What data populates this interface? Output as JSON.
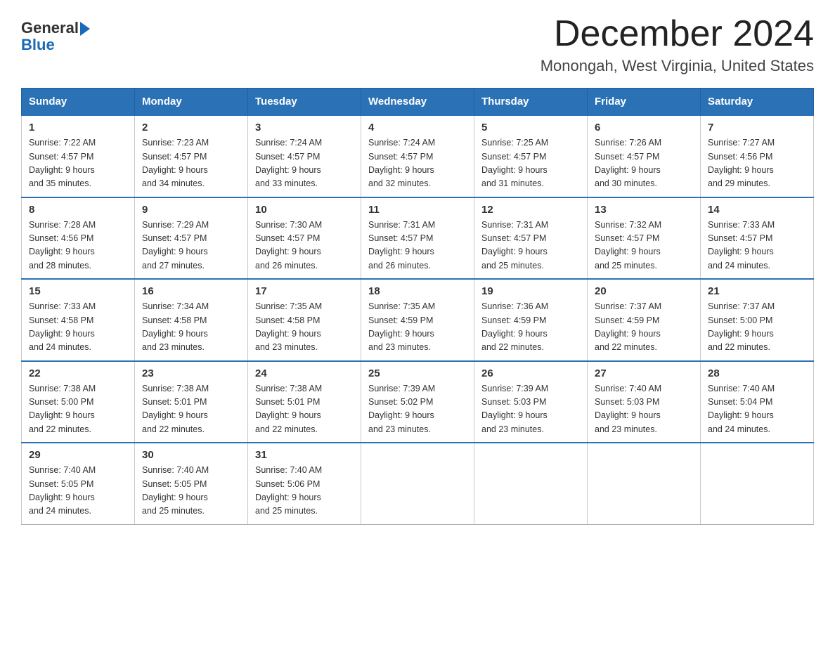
{
  "header": {
    "logo_text_general": "General",
    "logo_text_blue": "Blue",
    "month_title": "December 2024",
    "location": "Monongah, West Virginia, United States"
  },
  "days_of_week": [
    "Sunday",
    "Monday",
    "Tuesday",
    "Wednesday",
    "Thursday",
    "Friday",
    "Saturday"
  ],
  "weeks": [
    [
      {
        "day": "1",
        "sunrise": "7:22 AM",
        "sunset": "4:57 PM",
        "daylight": "9 hours and 35 minutes."
      },
      {
        "day": "2",
        "sunrise": "7:23 AM",
        "sunset": "4:57 PM",
        "daylight": "9 hours and 34 minutes."
      },
      {
        "day": "3",
        "sunrise": "7:24 AM",
        "sunset": "4:57 PM",
        "daylight": "9 hours and 33 minutes."
      },
      {
        "day": "4",
        "sunrise": "7:24 AM",
        "sunset": "4:57 PM",
        "daylight": "9 hours and 32 minutes."
      },
      {
        "day": "5",
        "sunrise": "7:25 AM",
        "sunset": "4:57 PM",
        "daylight": "9 hours and 31 minutes."
      },
      {
        "day": "6",
        "sunrise": "7:26 AM",
        "sunset": "4:57 PM",
        "daylight": "9 hours and 30 minutes."
      },
      {
        "day": "7",
        "sunrise": "7:27 AM",
        "sunset": "4:56 PM",
        "daylight": "9 hours and 29 minutes."
      }
    ],
    [
      {
        "day": "8",
        "sunrise": "7:28 AM",
        "sunset": "4:56 PM",
        "daylight": "9 hours and 28 minutes."
      },
      {
        "day": "9",
        "sunrise": "7:29 AM",
        "sunset": "4:57 PM",
        "daylight": "9 hours and 27 minutes."
      },
      {
        "day": "10",
        "sunrise": "7:30 AM",
        "sunset": "4:57 PM",
        "daylight": "9 hours and 26 minutes."
      },
      {
        "day": "11",
        "sunrise": "7:31 AM",
        "sunset": "4:57 PM",
        "daylight": "9 hours and 26 minutes."
      },
      {
        "day": "12",
        "sunrise": "7:31 AM",
        "sunset": "4:57 PM",
        "daylight": "9 hours and 25 minutes."
      },
      {
        "day": "13",
        "sunrise": "7:32 AM",
        "sunset": "4:57 PM",
        "daylight": "9 hours and 25 minutes."
      },
      {
        "day": "14",
        "sunrise": "7:33 AM",
        "sunset": "4:57 PM",
        "daylight": "9 hours and 24 minutes."
      }
    ],
    [
      {
        "day": "15",
        "sunrise": "7:33 AM",
        "sunset": "4:58 PM",
        "daylight": "9 hours and 24 minutes."
      },
      {
        "day": "16",
        "sunrise": "7:34 AM",
        "sunset": "4:58 PM",
        "daylight": "9 hours and 23 minutes."
      },
      {
        "day": "17",
        "sunrise": "7:35 AM",
        "sunset": "4:58 PM",
        "daylight": "9 hours and 23 minutes."
      },
      {
        "day": "18",
        "sunrise": "7:35 AM",
        "sunset": "4:59 PM",
        "daylight": "9 hours and 23 minutes."
      },
      {
        "day": "19",
        "sunrise": "7:36 AM",
        "sunset": "4:59 PM",
        "daylight": "9 hours and 22 minutes."
      },
      {
        "day": "20",
        "sunrise": "7:37 AM",
        "sunset": "4:59 PM",
        "daylight": "9 hours and 22 minutes."
      },
      {
        "day": "21",
        "sunrise": "7:37 AM",
        "sunset": "5:00 PM",
        "daylight": "9 hours and 22 minutes."
      }
    ],
    [
      {
        "day": "22",
        "sunrise": "7:38 AM",
        "sunset": "5:00 PM",
        "daylight": "9 hours and 22 minutes."
      },
      {
        "day": "23",
        "sunrise": "7:38 AM",
        "sunset": "5:01 PM",
        "daylight": "9 hours and 22 minutes."
      },
      {
        "day": "24",
        "sunrise": "7:38 AM",
        "sunset": "5:01 PM",
        "daylight": "9 hours and 22 minutes."
      },
      {
        "day": "25",
        "sunrise": "7:39 AM",
        "sunset": "5:02 PM",
        "daylight": "9 hours and 23 minutes."
      },
      {
        "day": "26",
        "sunrise": "7:39 AM",
        "sunset": "5:03 PM",
        "daylight": "9 hours and 23 minutes."
      },
      {
        "day": "27",
        "sunrise": "7:40 AM",
        "sunset": "5:03 PM",
        "daylight": "9 hours and 23 minutes."
      },
      {
        "day": "28",
        "sunrise": "7:40 AM",
        "sunset": "5:04 PM",
        "daylight": "9 hours and 24 minutes."
      }
    ],
    [
      {
        "day": "29",
        "sunrise": "7:40 AM",
        "sunset": "5:05 PM",
        "daylight": "9 hours and 24 minutes."
      },
      {
        "day": "30",
        "sunrise": "7:40 AM",
        "sunset": "5:05 PM",
        "daylight": "9 hours and 25 minutes."
      },
      {
        "day": "31",
        "sunrise": "7:40 AM",
        "sunset": "5:06 PM",
        "daylight": "9 hours and 25 minutes."
      },
      null,
      null,
      null,
      null
    ]
  ],
  "labels": {
    "sunrise": "Sunrise:",
    "sunset": "Sunset:",
    "daylight": "Daylight:"
  }
}
